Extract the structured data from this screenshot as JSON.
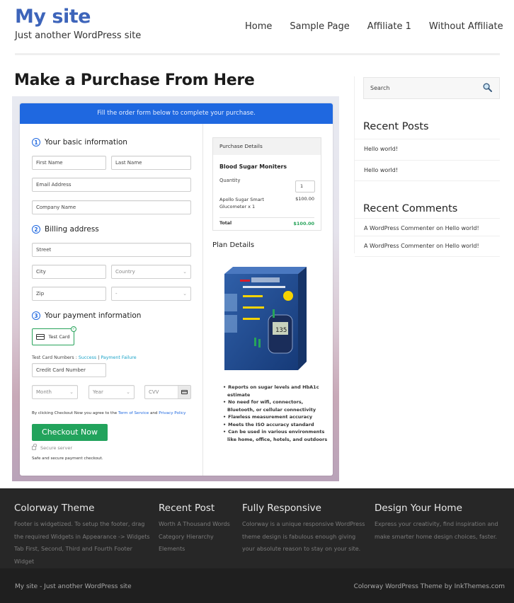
{
  "header": {
    "site_title": "My site",
    "tagline": "Just another WordPress site",
    "nav": [
      "Home",
      "Sample Page",
      "Affiliate 1",
      "Without Affiliate"
    ]
  },
  "page": {
    "title": "Make a Purchase From Here"
  },
  "checkout": {
    "banner": "Fill the order form below to complete your purchase.",
    "sections": {
      "basic": {
        "number": "1",
        "title": "Your basic information"
      },
      "billing": {
        "number": "2",
        "title": "Billing address"
      },
      "payment": {
        "number": "3",
        "title": "Your payment information"
      }
    },
    "fields": {
      "first_name": "First Name",
      "last_name": "Last Name",
      "email": "Email Address",
      "company": "Company Name",
      "street": "Street",
      "city": "City",
      "country": "Country",
      "zip": "Zip",
      "state": "-",
      "card_number": "Credit Card Number",
      "month": "Month",
      "year": "Year",
      "cvv": "CVV"
    },
    "payment_method": "Test Card",
    "test_numbers": {
      "label": "Test Card Numbers : ",
      "success": "Success",
      "separator": " | ",
      "failure": "Payment Failure"
    },
    "agree": {
      "prefix": "By clicking Checkout Now you agree to the ",
      "terms": "Term of Service",
      "and": " and ",
      "privacy": "Privacy Policy"
    },
    "checkout_button": "Checkout Now",
    "secure_server": "Secure server",
    "safe_text": "Safe and secure payment checkout.",
    "purchase_details": {
      "heading": "Purchase Details",
      "product": "Blood Sugar Moniters",
      "quantity_label": "Quantity",
      "quantity_value": "1",
      "item": "Apollo Sugar Smart Glucometer x 1",
      "item_price": "$100.00",
      "total_label": "Total",
      "total_value": "$100.00"
    },
    "plan_details": {
      "heading": "Plan Details",
      "image_alt": "On Call Plus Blood Glucose Monitoring System box",
      "features": [
        "Reports on sugar levels and HbA1c estimate",
        "No need for wifi, connectors, Bluetooth, or cellular connectivity",
        "Flawless measurement accuracy",
        "Meets the ISO accuracy standard",
        "Can be used in various environments like home, office, hotels, and outdoors"
      ]
    }
  },
  "sidebar": {
    "search_placeholder": "Search",
    "recent_posts_title": "Recent Posts",
    "recent_posts": [
      "Hello world!",
      "Hello world!"
    ],
    "recent_comments_title": "Recent Comments",
    "recent_comments": [
      "A WordPress Commenter on Hello world!",
      "A WordPress Commenter on Hello world!"
    ]
  },
  "footer": {
    "columns": [
      {
        "title": "Colorway Theme",
        "text": "Footer is widgetized. To setup the footer, drag the required Widgets in Appearance -> Widgets Tab First, Second, Third and Fourth Footer Widget"
      },
      {
        "title": "Recent Post",
        "links": [
          "Worth A Thousand Words",
          "Category Hierarchy",
          "Elements"
        ]
      },
      {
        "title": "Fully Responsive",
        "text": "Colorway is a unique responsive WordPress theme design is fabulous enough giving your absolute reason to stay on your site."
      },
      {
        "title": "Design Your Home",
        "text": "Express your creativity, find inspiration and make smarter home design choices, faster."
      }
    ],
    "bottom_left": "My site - Just another WordPress site",
    "bottom_right": "Colorway WordPress Theme by InkThemes.com"
  },
  "colors": {
    "brand_blue": "#3d64ba",
    "banner_blue": "#1f68e0",
    "checkout_green": "#22a35c",
    "link_teal": "#1aa3c8",
    "footer_bg": "#272727"
  }
}
